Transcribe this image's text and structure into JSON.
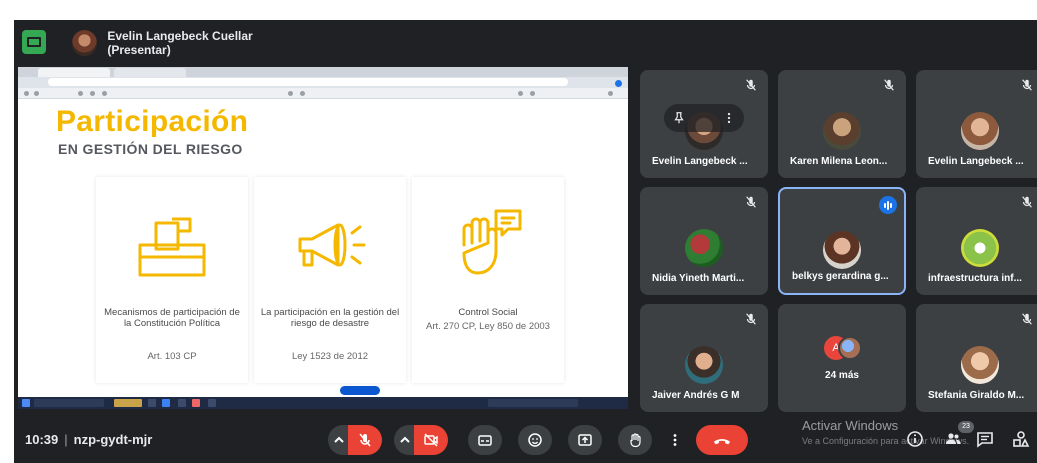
{
  "topbar": {
    "presenter_label": "Evelin Langebeck Cuellar (Presentar)"
  },
  "slide": {
    "title": "Participación",
    "subtitle": "EN GESTIÓN DEL RIESGO",
    "cards": [
      {
        "title": "Mecanismos de participación de la Constitución Política",
        "sub": "Art. 103 CP",
        "icon": "ballot-box-icon"
      },
      {
        "title": "La participación en la gestión del riesgo de desastre",
        "sub": "Ley 1523 de 2012",
        "icon": "megaphone-icon"
      },
      {
        "title": "Control Social",
        "sub": "Art. 270 CP, Ley 850 de 2003",
        "icon": "raised-hand-icon"
      }
    ]
  },
  "participants": [
    {
      "name": "Evelin Langebeck ...",
      "muted": true,
      "pinned_overlay": true
    },
    {
      "name": "Karen Milena Leon...",
      "muted": true
    },
    {
      "name": "Evelin Langebeck ...",
      "muted": true
    },
    {
      "name": "Nidia Yineth Marti...",
      "muted": true
    },
    {
      "name": "belkys gerardina g...",
      "muted": false,
      "speaking": true
    },
    {
      "name": "infraestructura inf...",
      "muted": true
    },
    {
      "name": "Jaiver Andrés G M",
      "muted": true
    },
    {
      "name": "24 más",
      "more": true,
      "initial": "A"
    },
    {
      "name": "Stefania Giraldo M...",
      "muted": true
    }
  ],
  "bottombar": {
    "time": "10:39",
    "meeting_code": "nzp-gydt-mjr",
    "activate_windows": "Activar Windows",
    "activate_windows_sub": "Ve a Configuración para activar Windows.",
    "participants_count": "23"
  },
  "colors": {
    "meet_bg": "#202124",
    "tile_bg": "#3c4043",
    "accent_green": "#34a853",
    "hangup_red": "#ea4335",
    "slide_yellow": "#f5b800",
    "active_border": "#8ab4f8"
  }
}
